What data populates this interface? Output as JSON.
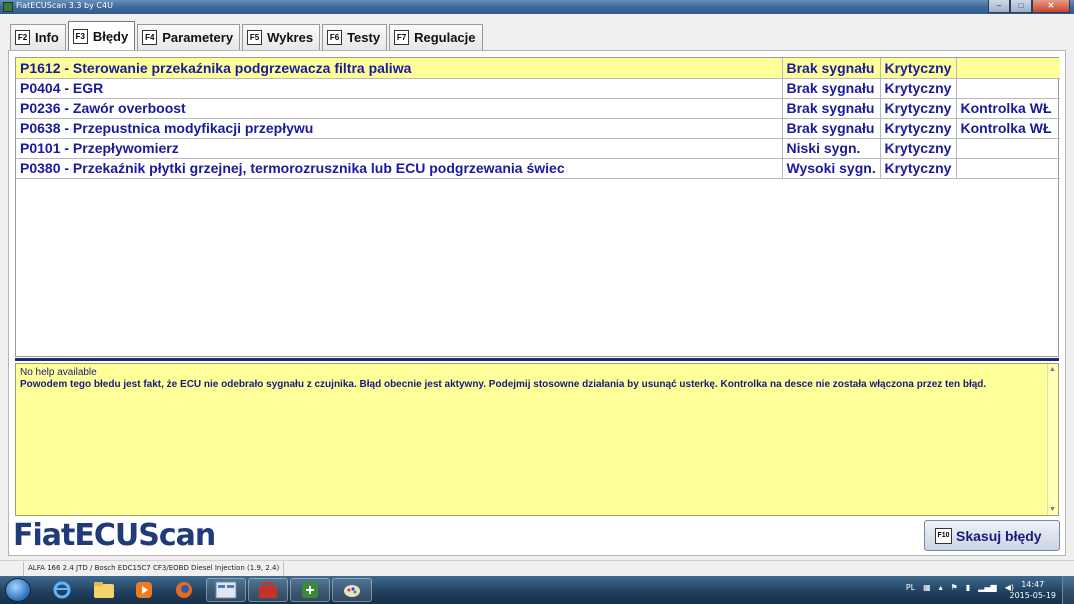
{
  "window": {
    "title": "FiatECUScan 3.3 by C4U",
    "min": "–",
    "max": "□",
    "close": "✕"
  },
  "tabs": [
    {
      "key": "F2",
      "label": "Info"
    },
    {
      "key": "F3",
      "label": "Błędy",
      "active": true
    },
    {
      "key": "F4",
      "label": "Parametery"
    },
    {
      "key": "F5",
      "label": "Wykres"
    },
    {
      "key": "F6",
      "label": "Testy"
    },
    {
      "key": "F7",
      "label": "Regulacje"
    }
  ],
  "errors": [
    {
      "code": "P1612 - Sterowanie przekaźnika podgrzewacza filtra paliwa",
      "signal": "Brak sygnału",
      "severity": "Krytyczny",
      "lamp": ""
    },
    {
      "code": "P0404 - EGR",
      "signal": "Brak sygnału",
      "severity": "Krytyczny",
      "lamp": ""
    },
    {
      "code": "P0236 - Zawór overboost",
      "signal": "Brak sygnału",
      "severity": "Krytyczny",
      "lamp": "Kontrolka WŁ"
    },
    {
      "code": "P0638 - Przepustnica modyfikacji przepływu",
      "signal": "Brak sygnału",
      "severity": "Krytyczny",
      "lamp": "Kontrolka WŁ"
    },
    {
      "code": "P0101 - Przepływomierz",
      "signal": "Niski sygn.",
      "severity": "Krytyczny",
      "lamp": ""
    },
    {
      "code": "P0380 - Przekaźnik płytki grzejnej, termorozrusznika lub ECU podgrzewania świec",
      "signal": "Wysoki sygn.",
      "severity": "Krytyczny",
      "lamp": ""
    }
  ],
  "help": {
    "line1": "No help available",
    "line2": "Powodem tego błedu jest fakt, że ECU nie odebrało sygnału z czujnika. Błąd obecnie jest aktywny. Podejmij stosowne działania by usunąć usterkę. Kontrolka na desce nie została włączona przez ten błąd."
  },
  "logo": "FiatECUScan",
  "clear_button": {
    "key": "F10",
    "label": "Skasuj błędy"
  },
  "status": {
    "vehicle": "ALFA 166 2.4 JTD / Bosch EDC15C7 CF3/EOBD Diesel Injection (1.9, 2.4)"
  },
  "taskbar": {
    "lang": "PL",
    "time": "14:47",
    "date": "2015-05-19"
  }
}
